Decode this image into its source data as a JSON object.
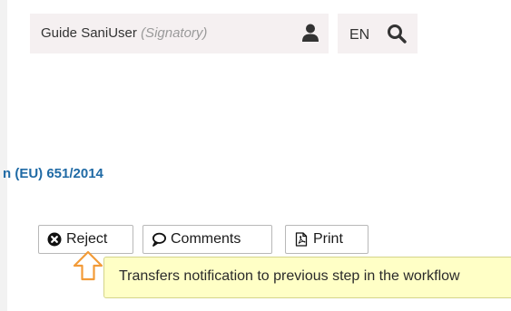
{
  "header": {
    "user_name": "Guide SaniUser",
    "user_role": "(Signatory)",
    "user_icon": "user-icon",
    "language": "EN",
    "search_icon": "search-icon"
  },
  "document": {
    "regulation_title": "n (EU) 651/2014"
  },
  "actions": {
    "reject": {
      "label": "Reject",
      "icon": "times-circle-icon"
    },
    "comments": {
      "label": "Comments",
      "icon": "comment-icon"
    },
    "print": {
      "label": "Print",
      "icon": "pdf-file-icon"
    }
  },
  "tooltip": {
    "text": "Transfers notification to previous step in the workflow"
  },
  "colors": {
    "link_blue": "#1f6aa5",
    "tooltip_bg": "#ffffc6",
    "pointer_orange": "#f29b38",
    "header_bg": "#f5f0f1"
  }
}
